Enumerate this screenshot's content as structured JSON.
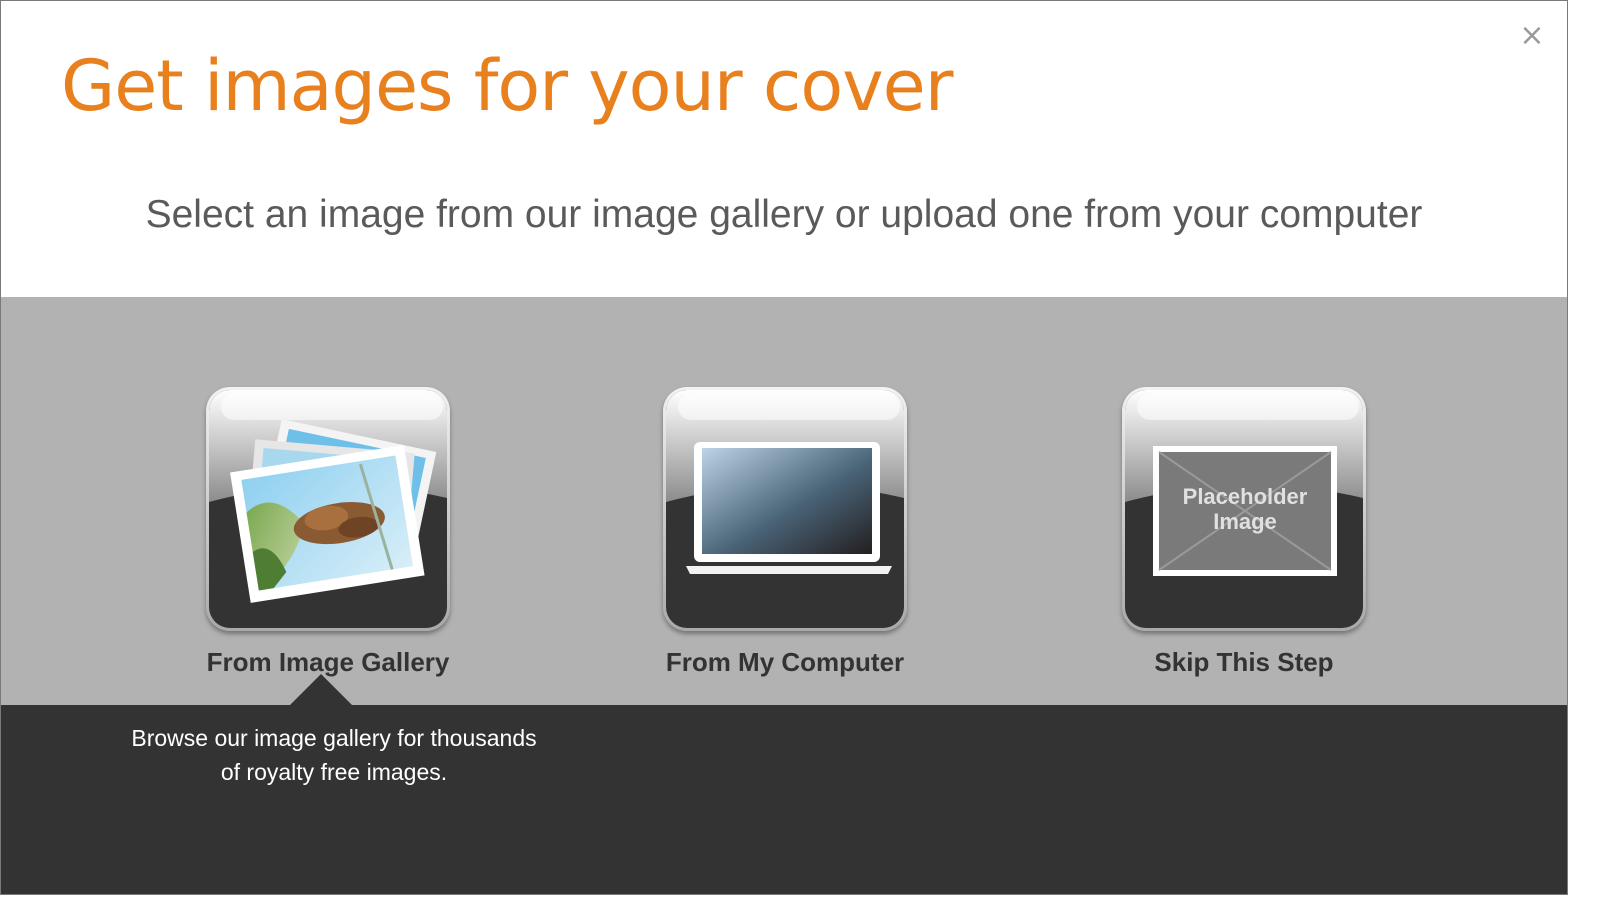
{
  "dialog": {
    "close_symbol": "×",
    "title": "Get images for your cover",
    "subtitle": "Select an image from our image gallery or upload one from your computer"
  },
  "options": [
    {
      "label": "From Image Gallery",
      "icon": "photo-stack-icon",
      "selected": true
    },
    {
      "label": "From My Computer",
      "icon": "laptop-icon",
      "selected": false
    },
    {
      "label": "Skip This Step",
      "icon": "placeholder-image-icon",
      "selected": false
    }
  ],
  "placeholder_text": [
    "Placeholder",
    "Image"
  ],
  "description": {
    "line1": "Browse our image gallery for thousands",
    "line2": "of royalty free images."
  },
  "colors": {
    "title": "#e8801e",
    "subtitle": "#5a5a5a",
    "options_band": "#b2b2b2",
    "info_panel": "#333333"
  }
}
